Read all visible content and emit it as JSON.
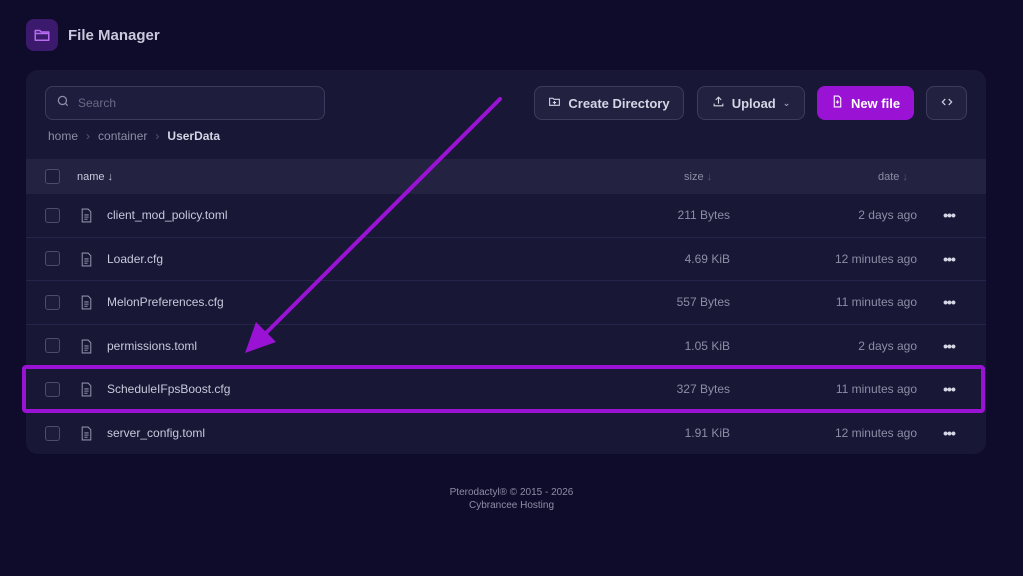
{
  "header": {
    "title": "File Manager",
    "icon": "folder-icon"
  },
  "search": {
    "placeholder": "Search",
    "value": ""
  },
  "toolbar": {
    "create_directory_label": "Create Directory",
    "upload_label": "Upload",
    "new_file_label": "New file"
  },
  "breadcrumb": {
    "items": [
      "home",
      "container"
    ],
    "current": "UserData"
  },
  "table": {
    "columns": {
      "name": "name",
      "size": "size",
      "date": "date"
    },
    "sort_arrow": "↓",
    "rows": [
      {
        "name": "client_mod_policy.toml",
        "size": "211 Bytes",
        "date": "2 days ago"
      },
      {
        "name": "Loader.cfg",
        "size": "4.69 KiB",
        "date": "12 minutes ago"
      },
      {
        "name": "MelonPreferences.cfg",
        "size": "557 Bytes",
        "date": "11 minutes ago"
      },
      {
        "name": "permissions.toml",
        "size": "1.05 KiB",
        "date": "2 days ago"
      },
      {
        "name": "ScheduleIFpsBoost.cfg",
        "size": "327 Bytes",
        "date": "11 minutes ago"
      },
      {
        "name": "server_config.toml",
        "size": "1.91 KiB",
        "date": "12 minutes ago"
      }
    ]
  },
  "footer": {
    "line1": "Pterodactyl® © 2015 - 2026",
    "line2": "Cybrancee Hosting"
  },
  "colors": {
    "accent": "#9a12d4",
    "background": "#0e0c2a",
    "panel": "#181735"
  }
}
